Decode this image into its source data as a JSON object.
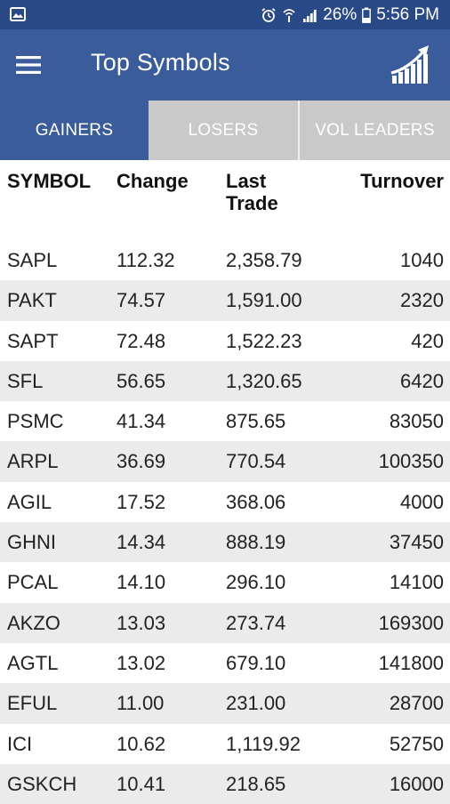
{
  "status_bar": {
    "battery": "26%",
    "time": "5:56 PM"
  },
  "app_bar": {
    "title": "Top Symbols",
    "menu_icon": "hamburger-menu-icon",
    "chart_icon": "trending-up-chart-icon"
  },
  "tabs": [
    {
      "label": "GAINERS",
      "active": true
    },
    {
      "label": "LOSERS",
      "active": false
    },
    {
      "label": "VOL LEADERS",
      "active": false
    }
  ],
  "table": {
    "headers": {
      "symbol": "SYMBOL",
      "change": "Change",
      "last_trade_line1": "Last",
      "last_trade_line2": "Trade",
      "turnover": "Turnover"
    },
    "rows": [
      {
        "symbol": "SAPL",
        "change": "112.32",
        "last": "2,358.79",
        "turnover": "1040"
      },
      {
        "symbol": "PAKT",
        "change": "74.57",
        "last": "1,591.00",
        "turnover": "2320"
      },
      {
        "symbol": "SAPT",
        "change": "72.48",
        "last": "1,522.23",
        "turnover": "420"
      },
      {
        "symbol": "SFL",
        "change": "56.65",
        "last": "1,320.65",
        "turnover": "6420"
      },
      {
        "symbol": "PSMC",
        "change": "41.34",
        "last": "875.65",
        "turnover": "83050"
      },
      {
        "symbol": "ARPL",
        "change": "36.69",
        "last": "770.54",
        "turnover": "100350"
      },
      {
        "symbol": "AGIL",
        "change": "17.52",
        "last": "368.06",
        "turnover": "4000"
      },
      {
        "symbol": "GHNI",
        "change": "14.34",
        "last": "888.19",
        "turnover": "37450"
      },
      {
        "symbol": "PCAL",
        "change": "14.10",
        "last": "296.10",
        "turnover": "14100"
      },
      {
        "symbol": "AKZO",
        "change": "13.03",
        "last": "273.74",
        "turnover": "169300"
      },
      {
        "symbol": "AGTL",
        "change": "13.02",
        "last": "679.10",
        "turnover": "141800"
      },
      {
        "symbol": "EFUL",
        "change": "11.00",
        "last": "231.00",
        "turnover": "28700"
      },
      {
        "symbol": "ICI",
        "change": "10.62",
        "last": "1,119.92",
        "turnover": "52750"
      },
      {
        "symbol": "GSKCH",
        "change": "10.41",
        "last": "218.65",
        "turnover": "16000"
      }
    ]
  },
  "colors": {
    "status_bar_bg": "#2a4a87",
    "app_bar_bg": "#3a5c9a",
    "tab_inactive_bg": "#c9c9c9",
    "row_alt_bg": "#ebebeb"
  }
}
